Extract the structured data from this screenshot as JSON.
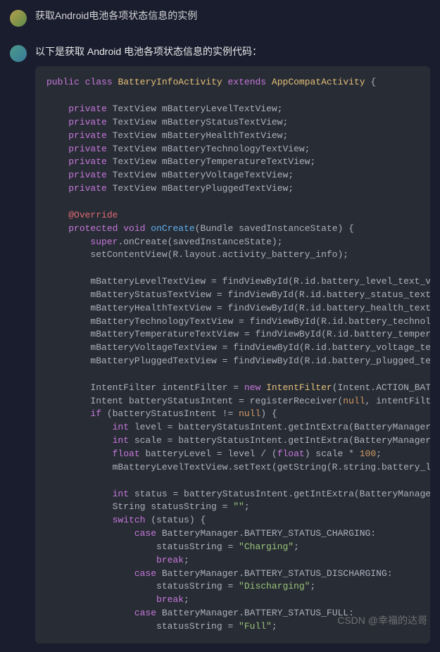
{
  "user_message": "获取Android电池各项状态信息的实例",
  "bot_intro": "以下是获取 Android 电池各项状态信息的实例代码：",
  "watermark": "CSDN @幸福的达哥",
  "code": {
    "line1": {
      "public": "public",
      "class": "class",
      "name": "BatteryInfoActivity",
      "extends": "extends",
      "parent": "AppCompatActivity",
      "brace": " {"
    },
    "fields": [
      {
        "access": "private",
        "type": " TextView mBatteryLevelTextView;"
      },
      {
        "access": "private",
        "type": " TextView mBatteryStatusTextView;"
      },
      {
        "access": "private",
        "type": " TextView mBatteryHealthTextView;"
      },
      {
        "access": "private",
        "type": " TextView mBatteryTechnologyTextView;"
      },
      {
        "access": "private",
        "type": " TextView mBatteryTemperatureTextView;"
      },
      {
        "access": "private",
        "type": " TextView mBatteryVoltageTextView;"
      },
      {
        "access": "private",
        "type": " TextView mBatteryPluggedTextView;"
      }
    ],
    "override": "@Override",
    "onCreate": {
      "protected": "protected",
      "void": "void",
      "name": "onCreate",
      "params": "(Bundle savedInstanceState)",
      "brace": " {"
    },
    "superLine": {
      "super": "super",
      "rest": ".onCreate(savedInstanceState);"
    },
    "setContent": "        setContentView(R.layout.activity_battery_info);",
    "findViews": [
      "        mBatteryLevelTextView = findViewById(R.id.battery_level_text_vie",
      "        mBatteryStatusTextView = findViewById(R.id.battery_status_text_v",
      "        mBatteryHealthTextView = findViewById(R.id.battery_health_text_v",
      "        mBatteryTechnologyTextView = findViewById(R.id.battery_technolog",
      "        mBatteryTemperatureTextView = findViewById(R.id.battery_temperat",
      "        mBatteryVoltageTextView = findViewById(R.id.battery_voltage_text",
      "        mBatteryPluggedTextView = findViewById(R.id.battery_plugged_text"
    ],
    "intentFilter": {
      "pre": "        IntentFilter intentFilter = ",
      "new": "new",
      "cls": "IntentFilter",
      "post": "(Intent.ACTION_BATTE"
    },
    "register": {
      "pre": "        Intent batteryStatusIntent = registerReceiver(",
      "null": "null",
      "post": ", intentFilter"
    },
    "ifLine": {
      "if": "if",
      "pre": " (batteryStatusIntent != ",
      "null": "null",
      "post": ") {"
    },
    "intLevel": {
      "int": "int",
      "rest": " level = batteryStatusIntent.getIntExtra(BatteryManager.E"
    },
    "intScale": {
      "int": "int",
      "rest": " scale = batteryStatusIntent.getIntExtra(BatteryManager.E"
    },
    "floatLine": {
      "float": "float",
      "var": " batteryLevel = level / (",
      "cast": "float",
      "rest": ") scale * ",
      "num": "100",
      "semi": ";"
    },
    "setText1": "            mBatteryLevelTextView.setText(getString(R.string.battery_lev",
    "intStatus": {
      "int": "int",
      "rest": " status = batteryStatusIntent.getIntExtra(BatteryManager."
    },
    "statusStr": {
      "pre": "            String statusString = ",
      "str": "\"\"",
      "semi": ";"
    },
    "switchLine": {
      "switch": "switch",
      "rest": " (status) {"
    },
    "case1": {
      "case": "case",
      "rest": " BatteryManager.BATTERY_STATUS_CHARGING:"
    },
    "case1val": {
      "pre": "                    statusString = ",
      "str": "\"Charging\"",
      "semi": ";"
    },
    "break1": {
      "break": "break",
      "semi": ";"
    },
    "case2": {
      "case": "case",
      "rest": " BatteryManager.BATTERY_STATUS_DISCHARGING:"
    },
    "case2val": {
      "pre": "                    statusString = ",
      "str": "\"Discharging\"",
      "semi": ";"
    },
    "break2": {
      "break": "break",
      "semi": ";"
    },
    "case3": {
      "case": "case",
      "rest": " BatteryManager.BATTERY_STATUS_FULL:"
    },
    "case3val": {
      "pre": "                    statusString = ",
      "str": "\"Full\"",
      "semi": ";"
    }
  }
}
